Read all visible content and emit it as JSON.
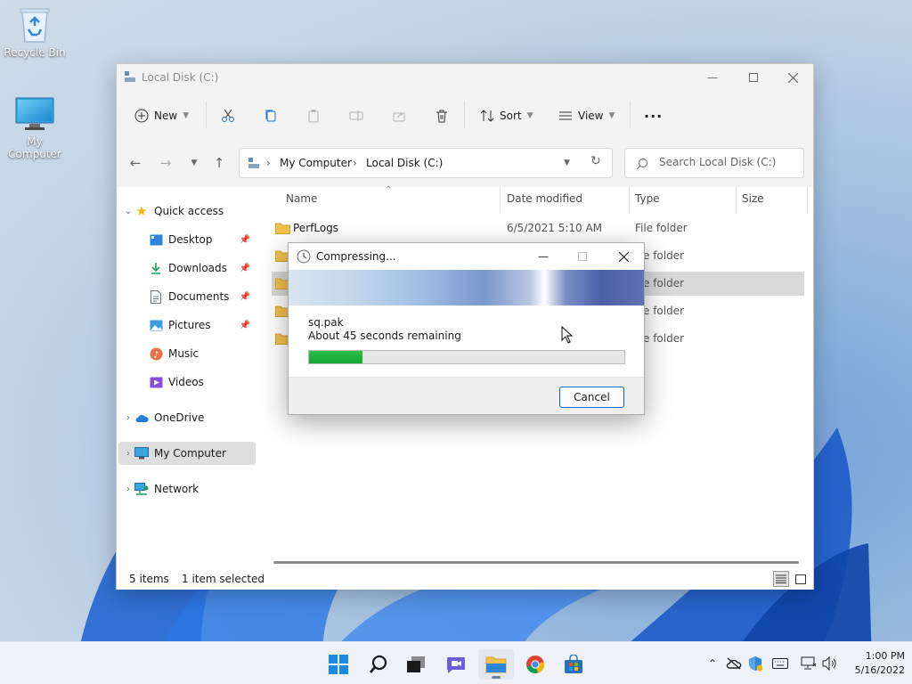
{
  "desktop": {
    "icons": [
      {
        "label": "Recycle Bin",
        "icon": "recycle-bin-icon"
      },
      {
        "label": "My Computer",
        "icon": "monitor-icon"
      }
    ]
  },
  "explorer": {
    "title": "Local Disk (C:)",
    "toolbar": {
      "new_label": "New",
      "sort_label": "Sort",
      "view_label": "View",
      "icons": [
        "cut-icon",
        "copy-icon",
        "paste-icon",
        "rename-icon",
        "share-icon",
        "delete-icon",
        "more-icon"
      ]
    },
    "address": {
      "segments": [
        "My Computer",
        "Local Disk (C:)"
      ]
    },
    "search": {
      "placeholder": "Search Local Disk (C:)"
    },
    "sidebar": {
      "items": [
        {
          "label": "Quick access",
          "icon": "star-icon"
        },
        {
          "label": "Desktop",
          "icon": "desktop-icon"
        },
        {
          "label": "Downloads",
          "icon": "download-icon"
        },
        {
          "label": "Documents",
          "icon": "document-icon"
        },
        {
          "label": "Pictures",
          "icon": "pictures-icon"
        },
        {
          "label": "Music",
          "icon": "music-icon"
        },
        {
          "label": "Videos",
          "icon": "video-icon"
        },
        {
          "label": "OneDrive",
          "icon": "cloud-icon"
        },
        {
          "label": "My Computer",
          "icon": "monitor-icon"
        },
        {
          "label": "Network",
          "icon": "network-icon"
        }
      ]
    },
    "columns": {
      "name": "Name",
      "date": "Date modified",
      "type": "Type",
      "size": "Size"
    },
    "rows": [
      {
        "name": "PerfLogs",
        "date": "6/5/2021 5:10 AM",
        "type": "File folder"
      },
      {
        "name": "",
        "date": "",
        "type": "e folder"
      },
      {
        "name": "",
        "date": "",
        "type": "e folder"
      },
      {
        "name": "",
        "date": "",
        "type": "e folder"
      },
      {
        "name": "",
        "date": "",
        "type": "e folder"
      }
    ],
    "status": {
      "items": "5 items",
      "selected": "1 item selected"
    }
  },
  "dialog": {
    "title": "Compressing...",
    "file": "sq.pak",
    "remaining": "About 45 seconds remaining",
    "progress": 0.17,
    "cancel_label": "Cancel"
  },
  "taskbar": {
    "apps": [
      "start-icon",
      "search-icon",
      "task-view-icon",
      "chat-icon",
      "file-explorer-icon",
      "chrome-icon",
      "store-icon"
    ],
    "time": "1:00 PM",
    "date": "5/16/2022"
  },
  "colors": {
    "accent": "#0067c0",
    "progress": "#14a832",
    "folder": "#f2c14e"
  }
}
